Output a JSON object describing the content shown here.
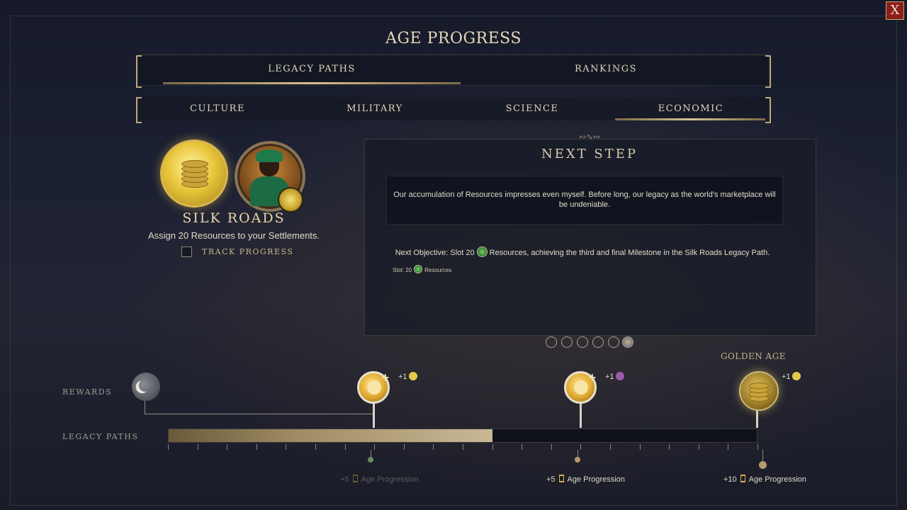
{
  "window": {
    "title": "AGE PROGRESS",
    "close_label": "X"
  },
  "top_tabs": [
    {
      "label": "LEGACY PATHS",
      "selected": true
    },
    {
      "label": "RANKINGS",
      "selected": false
    }
  ],
  "sub_tabs": [
    {
      "label": "CULTURE",
      "selected": false
    },
    {
      "label": "MILITARY",
      "selected": false
    },
    {
      "label": "SCIENCE",
      "selected": false
    },
    {
      "label": "ECONOMIC",
      "selected": true
    }
  ],
  "legacy_path": {
    "name": "SILK ROADS",
    "description": "Assign 20 Resources to your Settlements.",
    "track_progress_label": "TRACK PROGRESS",
    "track_progress_checked": false,
    "icon": "coin-stack-icon",
    "leader_icon": "leader-portrait"
  },
  "next_step": {
    "title": "NEXT STEP",
    "quote": "Our accumulation of Resources impresses even myself. Before long, our legacy as the world's marketplace will be undeniable.",
    "objective_prefix": "Next Objective: Slot 20",
    "objective_suffix": "Resources, achieving the third and final Milestone in the Silk Roads Legacy Path.",
    "slot_prefix": "Slot: 20",
    "slot_suffix": "Resources",
    "pages": 6,
    "active_page": 6
  },
  "timeline": {
    "rewards_label": "REWARDS",
    "legacy_paths_label": "LEGACY PATHS",
    "golden_age_label": "GOLDEN AGE",
    "progress_fraction": 0.55,
    "milestone_bonuses": [
      {
        "text": "+1",
        "icon": "gold-coin-icon",
        "color": "#e8c84a"
      },
      {
        "text": "+1",
        "icon": "purple-attribute-icon",
        "color": "#9a5ab0"
      },
      {
        "text": "+1",
        "icon": "gold-coin-icon",
        "color": "#e8c84a"
      }
    ],
    "age_rewards": [
      {
        "amount": "+5",
        "label": "Age Progression",
        "achieved": true
      },
      {
        "amount": "+5",
        "label": "Age Progression",
        "achieved": false
      },
      {
        "amount": "+10",
        "label": "Age Progression",
        "achieved": false
      }
    ]
  },
  "colors": {
    "accent_gold": "#d8c393",
    "close_red": "#8a1e1c"
  }
}
